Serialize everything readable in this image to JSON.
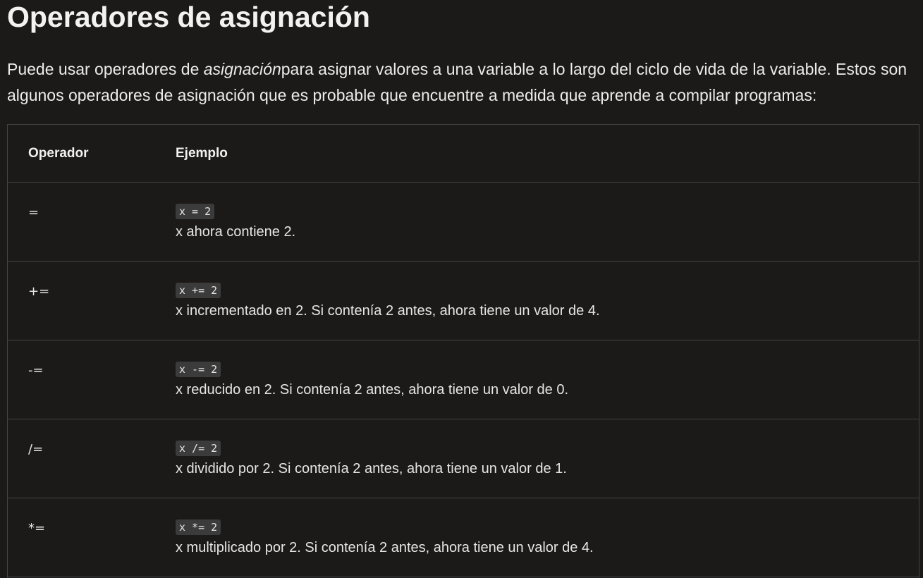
{
  "heading": "Operadores de asignación",
  "intro": {
    "before": "Puede usar operadores de ",
    "emphasis": "asignación",
    "after": "para asignar valores a una variable a lo largo del ciclo de vida de la variable. Estos son algunos operadores de asignación que es probable que encuentre a medida que aprende a compilar programas:"
  },
  "table": {
    "headers": {
      "operator": "Operador",
      "example": "Ejemplo"
    },
    "rows": [
      {
        "operator": "=",
        "code": "x = 2",
        "description": "x ahora contiene 2."
      },
      {
        "operator": "+=",
        "code": "x += 2",
        "description": "x incrementado en 2. Si contenía 2 antes, ahora tiene un valor de 4."
      },
      {
        "operator": "-=",
        "code": "x -= 2",
        "description": "x reducido en 2. Si contenía 2 antes, ahora tiene un valor de 0."
      },
      {
        "operator": "/=",
        "code": "x /= 2",
        "description": "x dividido por 2. Si contenía 2 antes, ahora tiene un valor de 1."
      },
      {
        "operator": "*=",
        "code": "x *= 2",
        "description": "x multiplicado por 2. Si contenía 2 antes, ahora tiene un valor de 4."
      }
    ]
  },
  "colors": {
    "background": "#1b1a19",
    "text": "#e6e6e6",
    "code_background": "#3b3b3b",
    "border": "#444444"
  }
}
